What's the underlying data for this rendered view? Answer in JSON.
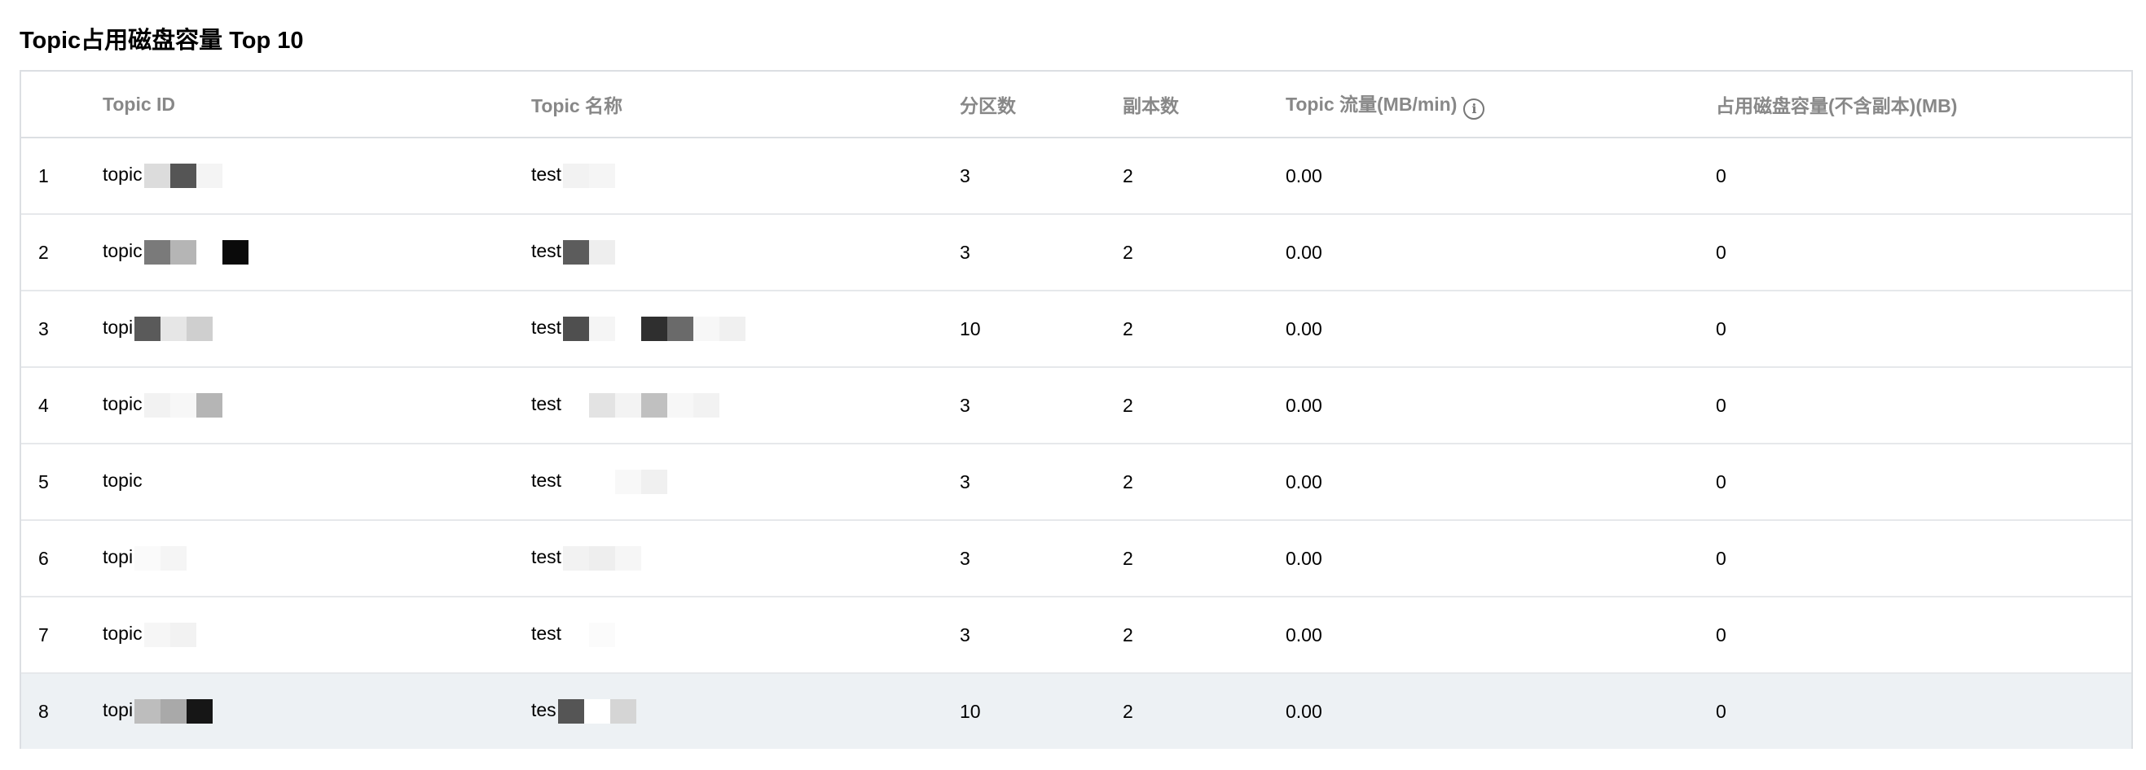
{
  "panel": {
    "title": "Topic占用磁盘容量 Top 10"
  },
  "table": {
    "headers": {
      "index": "",
      "topic_id": "Topic ID",
      "topic_name": "Topic 名称",
      "partitions": "分区数",
      "replicas": "副本数",
      "traffic": "Topic 流量(MB/min)",
      "disk_usage": "占用磁盘容量(不含副本)(MB)"
    },
    "rows": [
      {
        "index": "1",
        "topic_id": "topic",
        "topic_name": "test",
        "partitions": "3",
        "replicas": "2",
        "traffic": "0.00",
        "disk_usage": "0"
      },
      {
        "index": "2",
        "topic_id": "topic",
        "topic_name": "test",
        "partitions": "3",
        "replicas": "2",
        "traffic": "0.00",
        "disk_usage": "0"
      },
      {
        "index": "3",
        "topic_id": "topi",
        "topic_name": "test",
        "partitions": "10",
        "replicas": "2",
        "traffic": "0.00",
        "disk_usage": "0"
      },
      {
        "index": "4",
        "topic_id": "topic",
        "topic_name": "test",
        "partitions": "3",
        "replicas": "2",
        "traffic": "0.00",
        "disk_usage": "0"
      },
      {
        "index": "5",
        "topic_id": "topic",
        "topic_name": "test",
        "partitions": "3",
        "replicas": "2",
        "traffic": "0.00",
        "disk_usage": "0"
      },
      {
        "index": "6",
        "topic_id": "topi",
        "topic_name": "test",
        "partitions": "3",
        "replicas": "2",
        "traffic": "0.00",
        "disk_usage": "0"
      },
      {
        "index": "7",
        "topic_id": "topic",
        "topic_name": "test",
        "partitions": "3",
        "replicas": "2",
        "traffic": "0.00",
        "disk_usage": "0"
      },
      {
        "index": "8",
        "topic_id": "topi",
        "topic_name": "tes",
        "partitions": "10",
        "replicas": "2",
        "traffic": "0.00",
        "disk_usage": "0"
      }
    ],
    "highlighted_row": 8,
    "mosaic_shades": {
      "id": [
        [
          "#dcdcdc",
          "#555555",
          "#f4f4f4"
        ],
        [
          "#7a7a7a",
          "#b5b5b5",
          "#ffffff",
          "#0a0a0a"
        ],
        [
          "#5a5a5a",
          "#e6e6e6",
          "#cfcfcf"
        ],
        [
          "#f2f2f2",
          "#f7f7f7",
          "#b5b5b5"
        ],
        [],
        [
          "#fafafa",
          "#f5f5f5"
        ],
        [
          "#f6f6f6",
          "#f2f2f2"
        ],
        [
          "#bdbdbd",
          "#a9a9a9",
          "#161616"
        ]
      ],
      "name": [
        [
          "#f2f2f2",
          "#f5f5f5"
        ],
        [
          "#5c5c5c",
          "#eeeeee"
        ],
        [
          "#4f4f4f",
          "#f5f5f5",
          "#ffffff",
          "#2f2f2f",
          "#6a6a6a",
          "#f7f7f7",
          "#f0f0f0"
        ],
        [
          "#ffffff",
          "#e3e3e3",
          "#f3f3f3",
          "#c0c0c0",
          "#f7f7f7",
          "#f2f2f2"
        ],
        [
          "#ffffff",
          "#ffffff",
          "#f8f8f8",
          "#f0f0f0"
        ],
        [
          "#f2f2f2",
          "#eeeeee",
          "#f6f6f6"
        ],
        [
          "#ffffff",
          "#fbfbfb"
        ],
        [
          "#555555",
          "#ffffff",
          "#d5d5d5"
        ]
      ]
    },
    "colors": {
      "header_text": "#888888",
      "border": "#dcdfe3",
      "highlight_bg": "#edf1f4"
    }
  }
}
